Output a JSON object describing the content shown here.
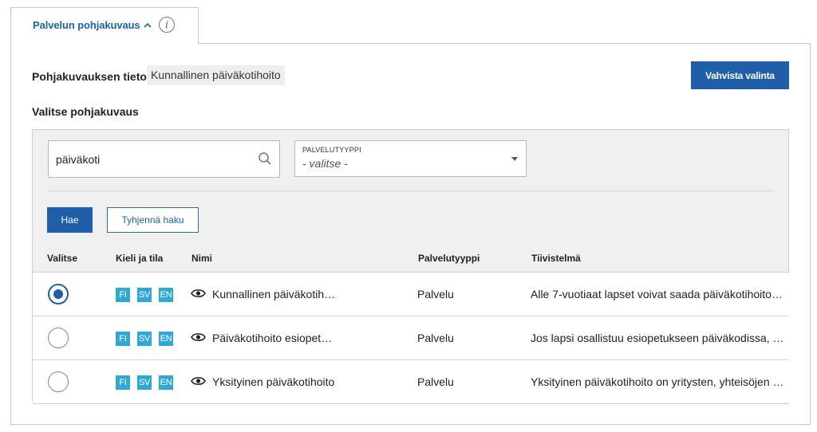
{
  "tab": {
    "label": "Palvelun pohjakuvaus",
    "info_symbol": "i"
  },
  "field": {
    "title": "Pohjakuvauksen tieto",
    "value": "Kunnallinen päiväkotihoito"
  },
  "confirm_label": "Vahvista valinta",
  "section_title": "Valitse pohjakuvaus",
  "search": {
    "value": "päiväkoti"
  },
  "type_filter": {
    "label": "PALVELUTYYPPI",
    "value": "- valitse -"
  },
  "buttons": {
    "search_label": "Hae",
    "clear_label": "Tyhjennä haku"
  },
  "table": {
    "headers": {
      "select": "Valitse",
      "language": "Kieli ja tila",
      "name": "Nimi",
      "type": "Palvelutyyppi",
      "summary": "Tiivistelmä"
    },
    "rows": [
      {
        "selected": true,
        "langs": [
          "FI",
          "SV",
          "EN"
        ],
        "name": "Kunnallinen päiväkotih…",
        "type": "Palvelu",
        "summary": "Alle 7-vuotiaat lapset voivat saada päiväkotihoito…"
      },
      {
        "selected": false,
        "langs": [
          "FI",
          "SV",
          "EN"
        ],
        "name": "Päiväkotihoito esiopet…",
        "type": "Palvelu",
        "summary": "Jos lapsi osallistuu esiopetukseen päiväkodissa, o…"
      },
      {
        "selected": false,
        "langs": [
          "FI",
          "SV",
          "EN"
        ],
        "name": "Yksityinen päiväkotihoito",
        "type": "Palvelu",
        "summary": "Yksityinen päiväkotihoito on yritysten, yhteisöjen …"
      }
    ]
  },
  "colors": {
    "primary": "#1f5fa9",
    "language_badge": "#2ea8d4"
  }
}
